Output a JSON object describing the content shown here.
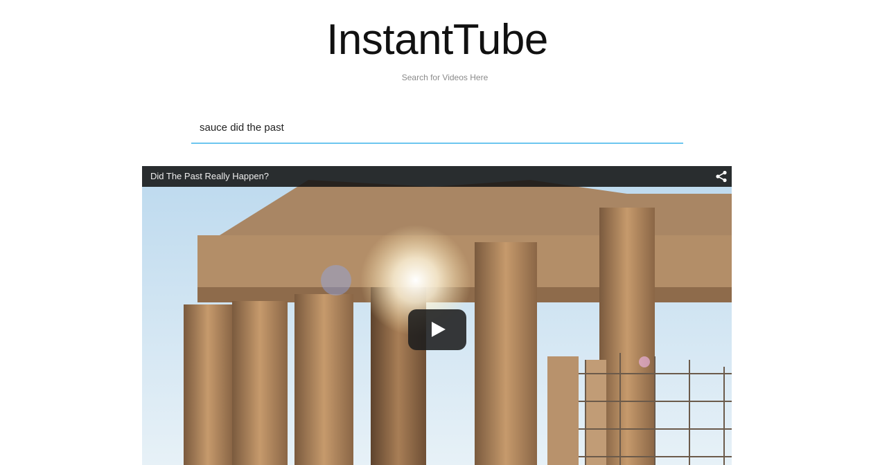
{
  "app": {
    "title": "InstantTube",
    "subtitle": "Search for Videos Here"
  },
  "search": {
    "value": "sauce did the past",
    "underline_color": "#6cc6ef"
  },
  "video": {
    "title": "Did The Past Really Happen?",
    "share_icon": "share-icon",
    "play_icon": "play-button-icon"
  }
}
